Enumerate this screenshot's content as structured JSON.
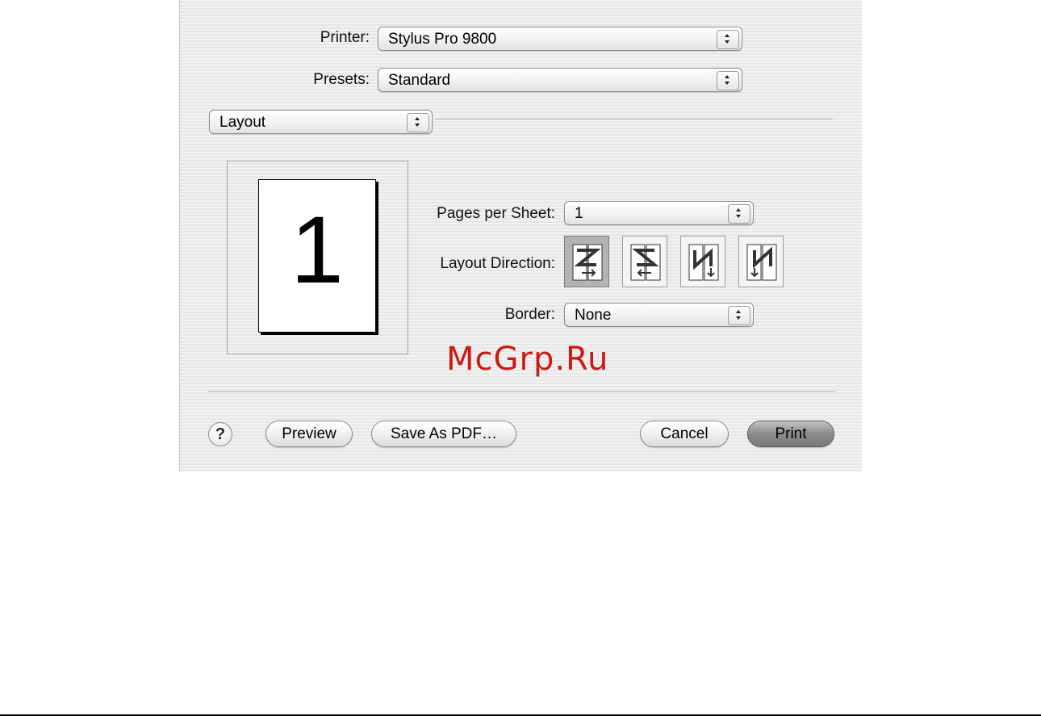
{
  "printer": {
    "label": "Printer:",
    "value": "Stylus Pro 9800"
  },
  "presets": {
    "label": "Presets:",
    "value": "Standard"
  },
  "panel_select": {
    "value": "Layout"
  },
  "preview": {
    "page_number": "1"
  },
  "pages_per_sheet": {
    "label": "Pages per Sheet:",
    "value": "1"
  },
  "layout_direction": {
    "label": "Layout Direction:",
    "options": [
      "z-left-right-icon",
      "z-right-left-icon",
      "n-top-bottom-left-icon",
      "n-top-bottom-right-icon"
    ],
    "selected_index": 0
  },
  "border": {
    "label": "Border:",
    "value": "None"
  },
  "watermark": "McGrp.Ru",
  "buttons": {
    "help": "?",
    "preview": "Preview",
    "save_pdf": "Save As PDF…",
    "cancel": "Cancel",
    "print": "Print"
  }
}
